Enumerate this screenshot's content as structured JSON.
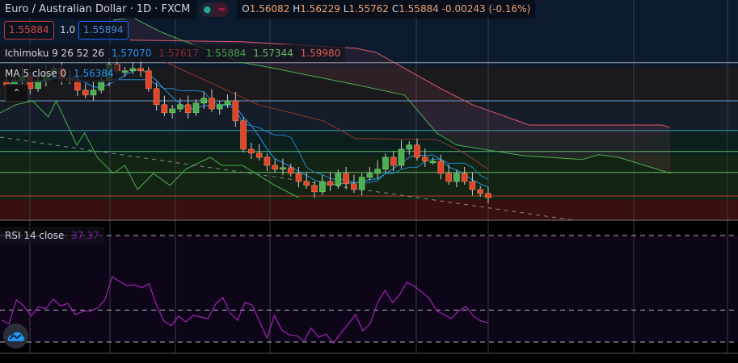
{
  "header": {
    "title": "Euro / Australian Dollar · 1D · FXCM",
    "open_label": "O",
    "open": "1.56082",
    "high_label": "H",
    "high": "1.56229",
    "low_label": "L",
    "low": "1.55762",
    "close_label": "C",
    "close": "1.55884",
    "change": "-0.00243 (-0.16%)",
    "status_dot": "●",
    "wave_icon": "≈"
  },
  "quote": {
    "bid": "1.55884",
    "spread": "1.0",
    "ask": "1.55894"
  },
  "ichimoku": {
    "label": "Ichimoku 9 26 52 26",
    "conversion": "1.57070",
    "base": "1.57617",
    "lagging": "1.55884",
    "lead_a": "1.57344",
    "lead_b": "1.59980"
  },
  "ma": {
    "label": "MA 5 close 0",
    "value": "1.56384"
  },
  "rsi": {
    "label": "RSI 14 close",
    "value": "37.37",
    "levels": [
      70,
      42,
      30
    ]
  },
  "colors": {
    "bull": "#4caf50",
    "bear": "#e0442c",
    "ma": "#2196f3",
    "rsi": "#9c27b0",
    "lead_a": "#4caf50",
    "lead_b": "#e05a6a",
    "base": "#8d3a2a"
  },
  "chart_data": {
    "type": "candlestick",
    "price_range": [
      1.5518,
      1.6143
    ],
    "closes": [
      1.5938,
      1.5951,
      1.5963,
      1.5926,
      1.5951,
      1.5971,
      1.5988,
      1.5956,
      1.5951,
      1.5921,
      1.5906,
      1.5921,
      1.5951,
      1.6001,
      1.5981,
      1.5981,
      1.5988,
      1.5981,
      1.5926,
      1.5876,
      1.5851,
      1.5863,
      1.5876,
      1.5851,
      1.5881,
      1.5896,
      1.5863,
      1.5876,
      1.5888,
      1.5826,
      1.5738,
      1.5726,
      1.5713,
      1.5688,
      1.5676,
      1.5681,
      1.5663,
      1.5638,
      1.5626,
      1.5606,
      1.5638,
      1.5626,
      1.5663,
      1.5631,
      1.5613,
      1.5651,
      1.5663,
      1.5676,
      1.5713,
      1.5688,
      1.5738,
      1.5751,
      1.5713,
      1.5701,
      1.5701,
      1.5663,
      1.5638,
      1.5663,
      1.5638,
      1.5613,
      1.5601,
      1.5588
    ],
    "lead_b": [
      [
        15.6,
        1.6076
      ],
      [
        29.9,
        1.6071
      ],
      [
        44.2,
        1.6051
      ],
      [
        46.8,
        1.6038
      ],
      [
        55,
        1.5926
      ],
      [
        59,
        1.5876
      ],
      [
        66.2,
        1.5813
      ],
      [
        83,
        1.5813
      ],
      [
        84,
        1.5806
      ]
    ],
    "lead_a": [
      [
        13.5,
        1.6138
      ],
      [
        16,
        1.6146
      ],
      [
        19.6,
        1.6101
      ],
      [
        24.8,
        1.6051
      ],
      [
        29.9,
        1.6006
      ],
      [
        33,
        1.5993
      ],
      [
        44.2,
        1.5938
      ],
      [
        50.4,
        1.5906
      ],
      [
        54.5,
        1.5788
      ],
      [
        57,
        1.5751
      ],
      [
        65.5,
        1.5718
      ],
      [
        72.9,
        1.5706
      ],
      [
        75,
        1.5721
      ],
      [
        77.5,
        1.5713
      ],
      [
        84.1,
        1.5663
      ]
    ],
    "lagging": [
      [
        -0.8,
        1.5851
      ],
      [
        1.2,
        1.5876
      ],
      [
        3.3,
        1.5888
      ],
      [
        5.3,
        1.5838
      ],
      [
        6.3,
        1.5888
      ],
      [
        8.9,
        1.5751
      ],
      [
        9.9,
        1.5788
      ],
      [
        11.5,
        1.5713
      ],
      [
        13.5,
        1.5663
      ],
      [
        15,
        1.5688
      ],
      [
        16.6,
        1.5613
      ],
      [
        18.6,
        1.5663
      ],
      [
        20.7,
        1.5626
      ],
      [
        22.7,
        1.5676
      ],
      [
        25.8,
        1.5713
      ],
      [
        27.3,
        1.5688
      ],
      [
        29.9,
        1.5688
      ],
      [
        34,
        1.5626
      ],
      [
        37,
        1.5588
      ]
    ],
    "base": [
      [
        19.7,
        1.6013
      ],
      [
        31.9,
        1.5876
      ],
      [
        40.1,
        1.5826
      ],
      [
        44.2,
        1.5771
      ],
      [
        54.5,
        1.5768
      ],
      [
        58,
        1.5726
      ],
      [
        61,
        1.5676
      ]
    ],
    "hlines": [
      1.6006,
      1.5888,
      1.5796,
      1.5731,
      1.5666,
      1.5593
    ],
    "rsi_values": [
      38.3,
      36.8,
      45.8,
      43.6,
      39.8,
      43.3,
      42.5,
      46.1,
      43.6,
      44.5,
      40.3,
      41.5,
      41.6,
      42.8,
      45.8,
      54.6,
      52.7,
      51.2,
      51.5,
      50.4,
      51.9,
      43.9,
      37.9,
      36.1,
      39.7,
      37.6,
      40,
      39.4,
      38.8,
      44.2,
      46.7,
      40.9,
      38.2,
      44.8,
      43.9,
      37.6,
      31.5,
      40,
      34.5,
      32.7,
      32.4,
      30.3,
      35.2,
      31.8,
      33,
      29.5,
      33.3,
      36.7,
      40.3,
      34.2,
      37,
      44.8,
      49.4,
      44.8,
      47.9,
      52.4,
      50.9,
      48.8,
      46.4,
      41.8,
      40.3,
      38.8,
      41.8,
      43.3,
      39.7,
      37.9,
      37.3
    ]
  }
}
